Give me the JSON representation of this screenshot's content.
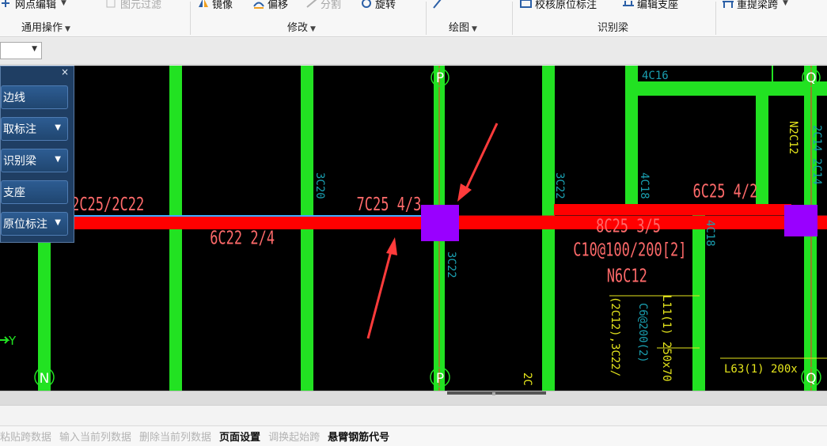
{
  "ribbon": {
    "row_items": [
      {
        "label": "网点编辑",
        "dim": false,
        "icon": "grid-edit-icon",
        "caret": true
      },
      {
        "label": "图元过滤",
        "dim": true,
        "icon": "filter-icon",
        "caret": false
      },
      {
        "label": "镜像",
        "dim": false,
        "icon": "mirror-icon",
        "caret": false
      },
      {
        "label": "偏移",
        "dim": false,
        "icon": "offset-icon",
        "caret": false
      },
      {
        "label": "分割",
        "dim": true,
        "icon": "split-icon",
        "caret": false
      },
      {
        "label": "旋转",
        "dim": false,
        "icon": "rotate-icon",
        "caret": false
      },
      {
        "label": "校核原位标注",
        "dim": false,
        "icon": "check-annotation-icon",
        "caret": false
      },
      {
        "label": "编辑支座",
        "dim": false,
        "icon": "edit-support-icon",
        "caret": false
      },
      {
        "label": "重提梁跨",
        "dim": false,
        "icon": "re-extract-span-icon",
        "caret": true
      }
    ],
    "groups": [
      "通用操作",
      "修改",
      "绘图",
      "识别梁"
    ]
  },
  "panel": {
    "close": "×",
    "buttons": [
      {
        "label": "边线",
        "has_caret": false
      },
      {
        "label": "取标注",
        "has_caret": true
      },
      {
        "label": "识别梁",
        "has_caret": true
      },
      {
        "label": "支座",
        "has_caret": false
      },
      {
        "label": "原位标注",
        "has_caret": true
      }
    ]
  },
  "cad": {
    "axis_labels": [
      "P",
      "Q",
      "N",
      "P",
      "Q"
    ],
    "axis_y_label": "Y",
    "annotations_red": [
      "2C25/2C22",
      "7C25 4/3",
      "6C22 2/4",
      "6C25 4/2",
      "8C25 3/5",
      "C10@100/200[2]",
      "N6C12"
    ],
    "annotations_blue": [
      "4C16",
      "3C20",
      "3C22",
      "3C22",
      "4C18",
      "4C18",
      "2C14 2C14",
      "C6@200(2)"
    ],
    "annotations_yellow": [
      "N2C12",
      "L11(1) 250x70",
      "(2C12),3C22/",
      "L63(1) 200x",
      "2C"
    ]
  },
  "statusbar": {
    "items": [
      {
        "label": "粘贴跨数据",
        "on": false
      },
      {
        "label": "输入当前列数据",
        "on": false
      },
      {
        "label": "删除当前列数据",
        "on": false
      },
      {
        "label": "页面设置",
        "on": true
      },
      {
        "label": "调换起始跨",
        "on": false
      },
      {
        "label": "悬臂钢筋代号",
        "on": true
      }
    ]
  },
  "colors": {
    "beam_selected": "#ff0000",
    "beam": "#22e222",
    "column_highlight": "#9900ff",
    "annotation_red": "#ff6a6a",
    "annotation_blue": "#1a9fb0",
    "annotation_yellow": "#e6e61c",
    "panel_bg": "#1f3e63"
  }
}
